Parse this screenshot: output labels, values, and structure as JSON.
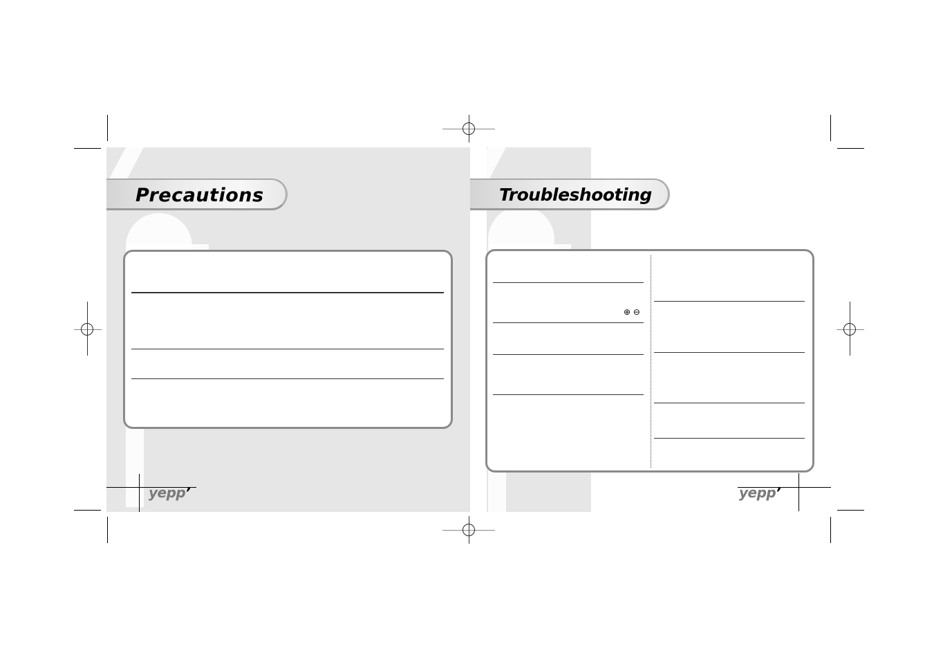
{
  "left_page": {
    "title": "Precautions",
    "logo": {
      "text": "epp",
      "prefix": "y",
      "suffix": "’"
    }
  },
  "right_page": {
    "title": "Troubleshooting",
    "polarity_symbols": "⊕ ⊖",
    "logo": {
      "text": "epp",
      "prefix": "y",
      "suffix": "’"
    }
  },
  "colors": {
    "page_background": "#e6e6e6",
    "box_border": "#8a8a8a",
    "logo_gray": "#7a7a7a"
  }
}
